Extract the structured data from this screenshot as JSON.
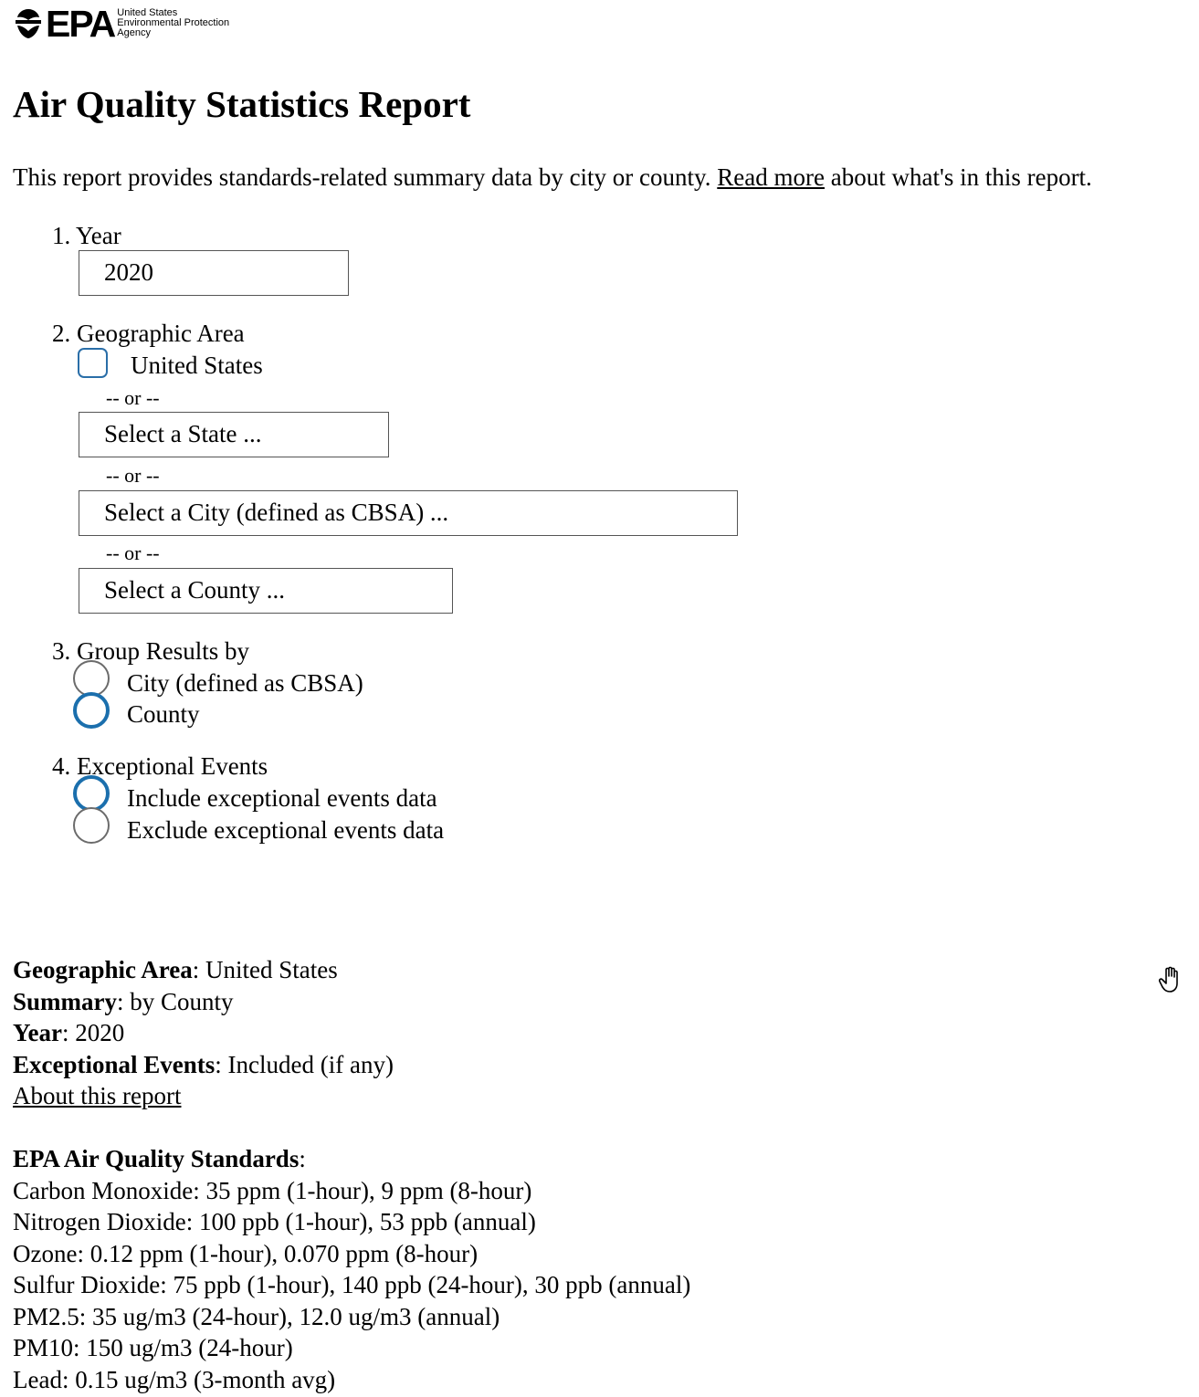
{
  "logo": {
    "wordmark": "EPA",
    "agency_lines": [
      "United States",
      "Environmental Protection",
      "Agency"
    ]
  },
  "page": {
    "title": "Air Quality Statistics Report",
    "intro_before": "This report provides standards-related summary data by city or county. ",
    "intro_link": "Read more",
    "intro_after": " about what's in this report."
  },
  "form": {
    "year": {
      "label": "1. Year",
      "value": "2020"
    },
    "geo": {
      "label": "2. Geographic Area",
      "us_checkbox_label": "United States",
      "us_checked": false,
      "or_text": "-- or --",
      "state_placeholder": "Select a State ...",
      "city_placeholder": "Select a City (defined as CBSA) ...",
      "county_placeholder": "Select a County ..."
    },
    "group": {
      "label": "3. Group Results by",
      "options": [
        "City (defined as CBSA)",
        "County"
      ],
      "selected": "County"
    },
    "events": {
      "label": "4. Exceptional Events",
      "options": [
        "Include exceptional events data",
        "Exclude exceptional events data"
      ],
      "selected": "Include exceptional events data"
    }
  },
  "summary": {
    "geo_label": "Geographic Area",
    "geo_value": ": United States",
    "summary_label": "Summary",
    "summary_value": ": by County",
    "year_label": "Year",
    "year_value": ": 2020",
    "events_label": "Exceptional Events",
    "events_value": ": Included (if any)",
    "about_link": "About this report"
  },
  "standards": {
    "heading": "EPA Air Quality Standards",
    "heading_suffix": ":",
    "items": [
      "Carbon Monoxide: 35 ppm (1-hour), 9 ppm (8-hour)",
      "Nitrogen Dioxide: 100 ppb (1-hour), 53 ppb (annual)",
      "Ozone: 0.12 ppm (1-hour), 0.070 ppm (8-hour)",
      "Sulfur Dioxide: 75 ppb (1-hour), 140 ppb (24-hour), 30 ppb (annual)",
      "PM2.5: 35 ug/m3 (24-hour), 12.0 ug/m3 (annual)",
      "PM10: 150 ug/m3 (24-hour)",
      "Lead: 0.15 ug/m3 (3-month avg)"
    ]
  },
  "icons": {
    "logo": "epa-flower-icon",
    "cursor": "hand-pointer-icon"
  },
  "colors": {
    "focus_blue": "#1b6fad",
    "checkbox_border": "#2a6ea8"
  }
}
